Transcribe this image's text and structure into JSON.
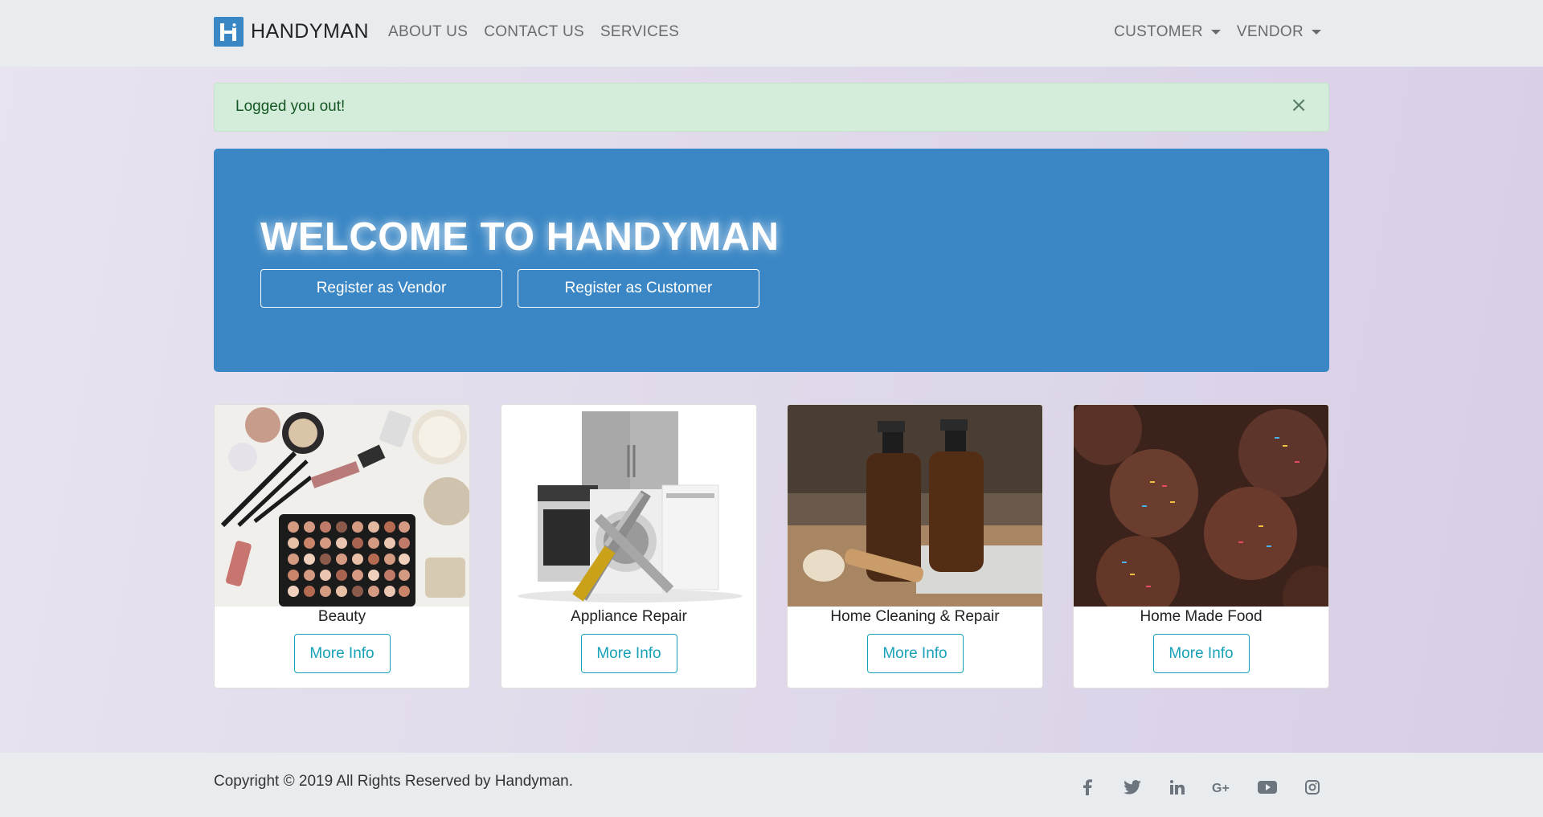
{
  "navbar": {
    "brand": "HANDYMAN",
    "links": [
      "ABOUT US",
      "CONTACT US",
      "SERVICES"
    ],
    "dropdowns": [
      "CUSTOMER",
      "VENDOR"
    ]
  },
  "alert": {
    "message": "Logged you out!",
    "close": "×"
  },
  "hero": {
    "title": "WELCOME TO HANDYMAN",
    "vendor_button": "Register as Vendor",
    "customer_button": "Register as Customer",
    "background": "#3b87c5"
  },
  "cards": [
    {
      "title": "Beauty",
      "button": "More Info"
    },
    {
      "title": "Appliance Repair",
      "button": "More Info"
    },
    {
      "title": "Home Cleaning & Repair",
      "button": "More Info"
    },
    {
      "title": "Home Made Food",
      "button": "More Info"
    }
  ],
  "footer": {
    "copyright": "Copyright © 2019 All Rights Reserved by Handyman.",
    "social": [
      "facebook-icon",
      "twitter-icon",
      "linkedin-icon",
      "google-plus-icon",
      "youtube-icon",
      "instagram-icon"
    ]
  },
  "colors": {
    "accent": "#3b87c5",
    "info": "#17a2b8",
    "alert_bg": "#d4edda",
    "alert_text": "#155724"
  }
}
